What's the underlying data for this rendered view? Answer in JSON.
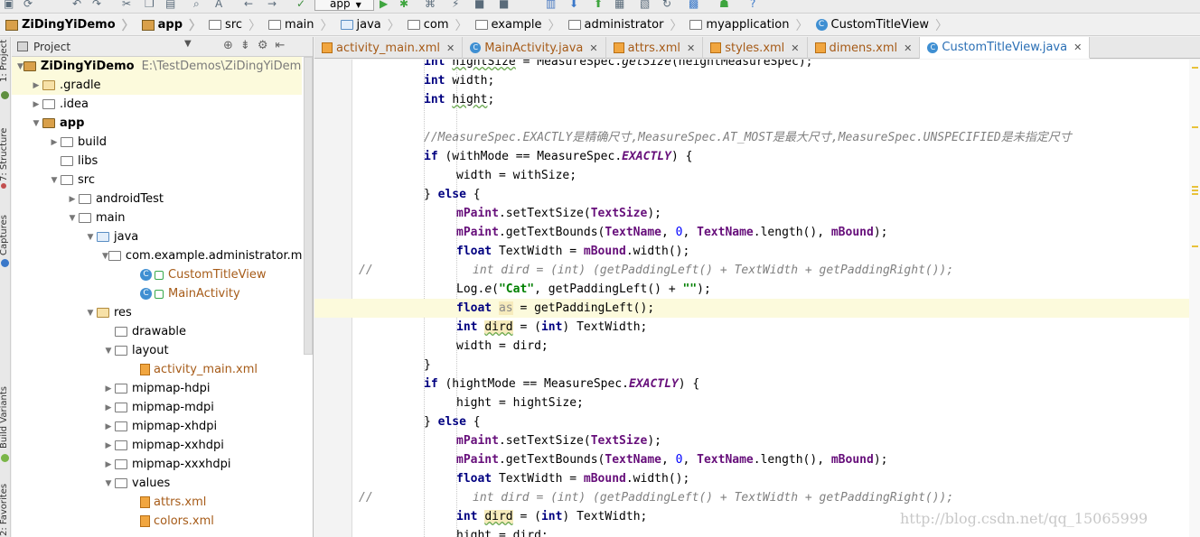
{
  "toolbar": {
    "run_config": "app"
  },
  "breadcrumbs": [
    "ZiDingYiDemo",
    "app",
    "src",
    "main",
    "java",
    "com",
    "example",
    "administrator",
    "myapplication",
    "CustomTitleView"
  ],
  "side_tabs": {
    "project": "1: Project",
    "structure": "7: Structure",
    "captures": "Captures",
    "build_variants": "Build Variants",
    "favorites": "2: Favorites"
  },
  "project_panel": {
    "title": "Project",
    "tree": [
      {
        "label": "ZiDingYiDemo",
        "path": "E:\\TestDemos\\ZiDingYiDemo"
      },
      {
        "label": ".gradle"
      },
      {
        "label": ".idea"
      },
      {
        "label": "app"
      },
      {
        "label": "build"
      },
      {
        "label": "libs"
      },
      {
        "label": "src"
      },
      {
        "label": "androidTest"
      },
      {
        "label": "main"
      },
      {
        "label": "java"
      },
      {
        "label": "com.example.administrator.myap"
      },
      {
        "label": "CustomTitleView"
      },
      {
        "label": "MainActivity"
      },
      {
        "label": "res"
      },
      {
        "label": "drawable"
      },
      {
        "label": "layout"
      },
      {
        "label": "activity_main.xml"
      },
      {
        "label": "mipmap-hdpi"
      },
      {
        "label": "mipmap-mdpi"
      },
      {
        "label": "mipmap-xhdpi"
      },
      {
        "label": "mipmap-xxhdpi"
      },
      {
        "label": "mipmap-xxxhdpi"
      },
      {
        "label": "values"
      },
      {
        "label": "attrs.xml"
      },
      {
        "label": "colors.xml"
      }
    ]
  },
  "editor_tabs": [
    "activity_main.xml",
    "MainActivity.java",
    "attrs.xml",
    "styles.xml",
    "dimens.xml",
    "CustomTitleView.java"
  ],
  "code": {
    "l0": [
      "int ",
      "hightSize",
      " = MeasureSpec.",
      "getSize",
      "(heightMeasureSpec);"
    ],
    "l1": [
      "int ",
      "width",
      ";"
    ],
    "l2": [
      "int ",
      "hight",
      ";"
    ],
    "l4": "//MeasureSpec.EXACTLY是精确尺寸,MeasureSpec.AT_MOST是最大尺寸,MeasureSpec.UNSPECIFIED是未指定尺寸",
    "l5": [
      "if",
      " (withMode == MeasureSpec.",
      "EXACTLY",
      ") {"
    ],
    "l6": "width = withSize;",
    "l7": [
      "} ",
      "else",
      " {"
    ],
    "l8": [
      "mPaint",
      ".setTextSize(",
      "TextSize",
      ");"
    ],
    "l9": [
      "mPaint",
      ".getTextBounds(",
      "TextName",
      ", ",
      "0",
      ", ",
      "TextName",
      ".length(), ",
      "mBound",
      ");"
    ],
    "l10": [
      "float",
      " TextWidth = ",
      "mBound",
      ".width();"
    ],
    "l11_gutter": "//",
    "l11": "int dird = (int) (getPaddingLeft() + TextWidth + getPaddingRight());",
    "l12": [
      "Log.",
      "e",
      "(",
      "\"Cat\"",
      ", getPaddingLeft() + ",
      "\"\"",
      ");"
    ],
    "l13": [
      "float ",
      "as",
      " = getPaddingLeft();"
    ],
    "l14": [
      "int ",
      "dird",
      " = (",
      "int",
      ") TextWidth;"
    ],
    "l15": "width = dird;",
    "l16": "}",
    "l17": [
      "if",
      " (hightMode == MeasureSpec.",
      "EXACTLY",
      ") {"
    ],
    "l18": "hight = hightSize;",
    "l19": [
      "} ",
      "else",
      " {"
    ],
    "l20": [
      "mPaint",
      ".setTextSize(",
      "TextSize",
      ");"
    ],
    "l21": [
      "mPaint",
      ".getTextBounds(",
      "TextName",
      ", ",
      "0",
      ", ",
      "TextName",
      ".length(), ",
      "mBound",
      ");"
    ],
    "l22": [
      "float",
      " TextWidth = ",
      "mBound",
      ".width();"
    ],
    "l23_gutter": "//",
    "l23": "int dird = (int) (getPaddingLeft() + TextWidth + getPaddingRight());",
    "l24": [
      "int ",
      "dird",
      " = (",
      "int",
      ") TextWidth;"
    ],
    "l25": "hight = dird;"
  },
  "watermark": "http://blog.csdn.net/qq_15065999"
}
